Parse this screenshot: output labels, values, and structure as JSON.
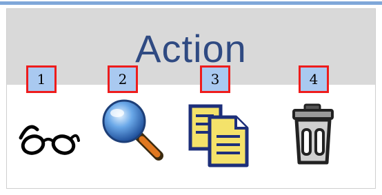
{
  "table": {
    "header": {
      "title": "Action"
    }
  },
  "badges": [
    "1",
    "2",
    "3",
    "4"
  ],
  "actions": [
    {
      "icon": "glasses-icon"
    },
    {
      "icon": "magnifier-icon"
    },
    {
      "icon": "copy-documents-icon"
    },
    {
      "icon": "trash-icon"
    }
  ],
  "colors": {
    "header_bg": "#d9d9d9",
    "title_text": "#2f4a82",
    "badge_bg": "#a9c9f0",
    "badge_border": "#ee1c1c",
    "top_rule": "#7fa7d9"
  }
}
